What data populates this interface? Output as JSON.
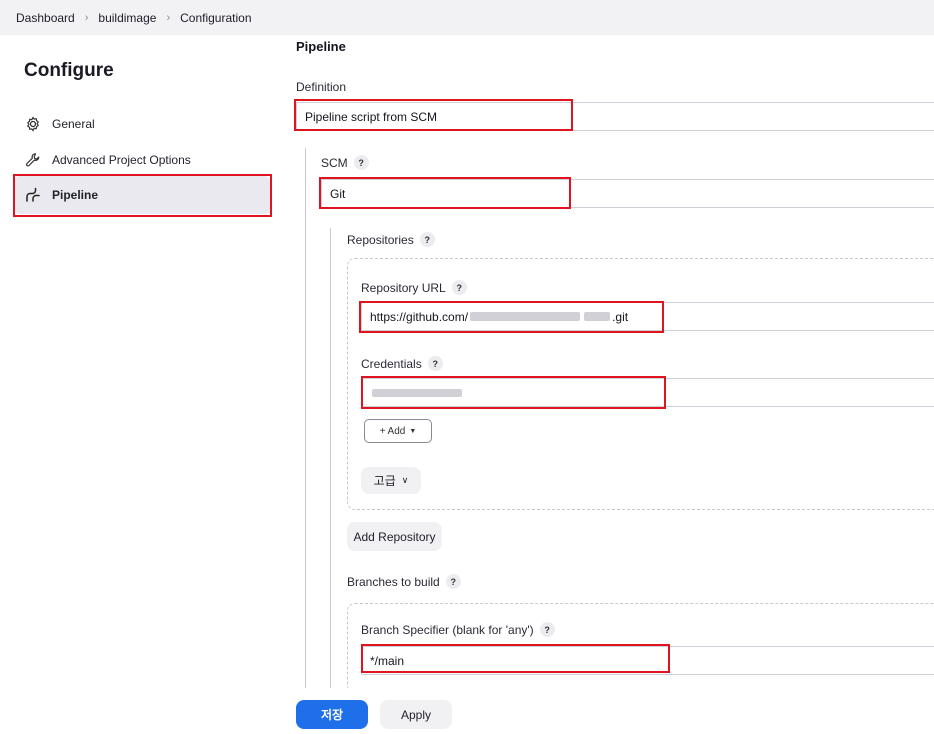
{
  "breadcrumb": {
    "items": [
      "Dashboard",
      "buildimage",
      "Configuration"
    ]
  },
  "sidebar": {
    "title": "Configure",
    "items": [
      {
        "label": "General",
        "icon": "gear-icon"
      },
      {
        "label": "Advanced Project Options",
        "icon": "wrench-icon"
      },
      {
        "label": "Pipeline",
        "icon": "pipeline-icon",
        "active": true
      }
    ]
  },
  "main": {
    "section_title": "Pipeline",
    "definition": {
      "label": "Definition",
      "value": "Pipeline script from SCM"
    },
    "scm": {
      "label": "SCM",
      "value": "Git"
    },
    "repositories": {
      "label": "Repositories",
      "url_label": "Repository URL",
      "url_prefix": "https://github.com/",
      "url_suffix": ".git",
      "credentials_label": "Credentials",
      "add_button": "Add",
      "advanced_button": "고급",
      "add_repository_button": "Add Repository"
    },
    "branches": {
      "label": "Branches to build",
      "specifier_label": "Branch Specifier (blank for 'any')",
      "specifier_value": "*/main"
    },
    "help_glyph": "?"
  },
  "footer": {
    "save_label": "저장",
    "apply_label": "Apply"
  },
  "colors": {
    "highlight": "#e0141e",
    "primary": "#1f6feb"
  }
}
